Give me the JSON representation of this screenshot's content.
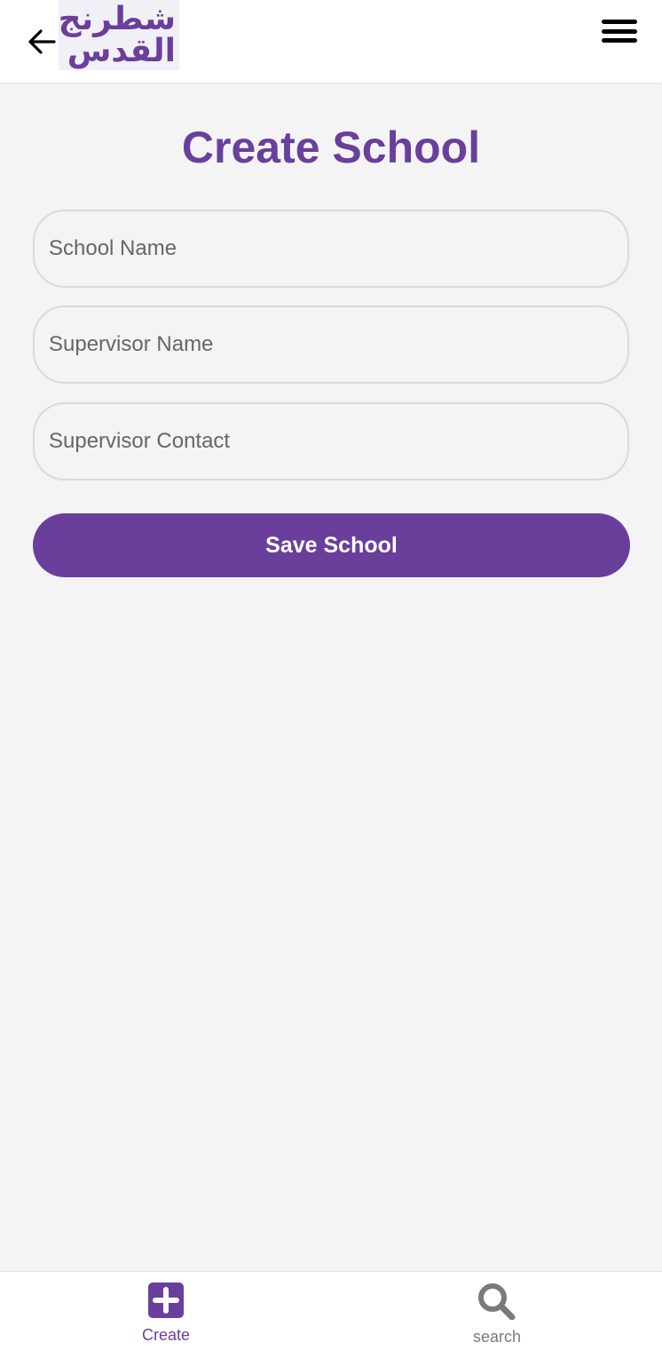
{
  "header": {
    "logo_line1": "شطرنج",
    "logo_line2": "القدس",
    "back_icon": "arrow-left-icon",
    "menu_icon": "hamburger-menu-icon"
  },
  "main": {
    "title": "Create School",
    "fields": {
      "school_name_placeholder": "School Name",
      "supervisor_name_placeholder": "Supervisor Name",
      "supervisor_contact_placeholder": "Supervisor Contact"
    },
    "save_label": "Save School"
  },
  "bottom_nav": {
    "items": [
      {
        "label": "Create",
        "icon": "plus-square-icon",
        "active": true
      },
      {
        "label": "search",
        "icon": "search-icon",
        "active": false
      }
    ]
  },
  "colors": {
    "brand": "#6a3f9b",
    "background": "#f4f4f5",
    "inactive": "#7a7a7a"
  }
}
